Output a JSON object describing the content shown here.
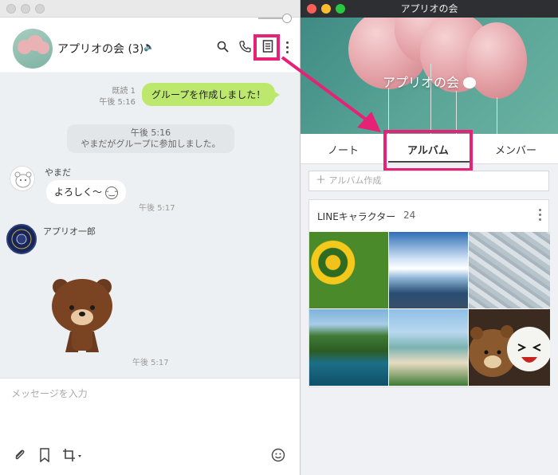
{
  "left_window": {
    "chat_title": "アプリオの会 (3)",
    "messages": {
      "me_text": "グループを作成しました！",
      "read_label": "既読 1",
      "me_time": "午後 5:16",
      "system_time": "午後 5:16",
      "system_text": "やまだがグループに参加しました。",
      "user1_name": "やまだ",
      "user1_text": "よろしく〜",
      "user1_time": "午後 5:17",
      "user2_name": "アプリオ一郎",
      "sticker_time": "午後 5:17"
    },
    "input_placeholder": "メッセージを入力"
  },
  "right_window": {
    "title": "アプリオの会",
    "hero_title": "アプリオの会",
    "tabs": [
      "ノート",
      "アルバム",
      "メンバー"
    ],
    "active_tab": "アルバム",
    "create_album": "アルバム作成",
    "album": {
      "name": "LINEキャラクター",
      "count": "24"
    }
  },
  "colors": {
    "highlight": "#e62277",
    "bubble_me": "#bde86e",
    "chat_bg": "#edf0f2"
  }
}
